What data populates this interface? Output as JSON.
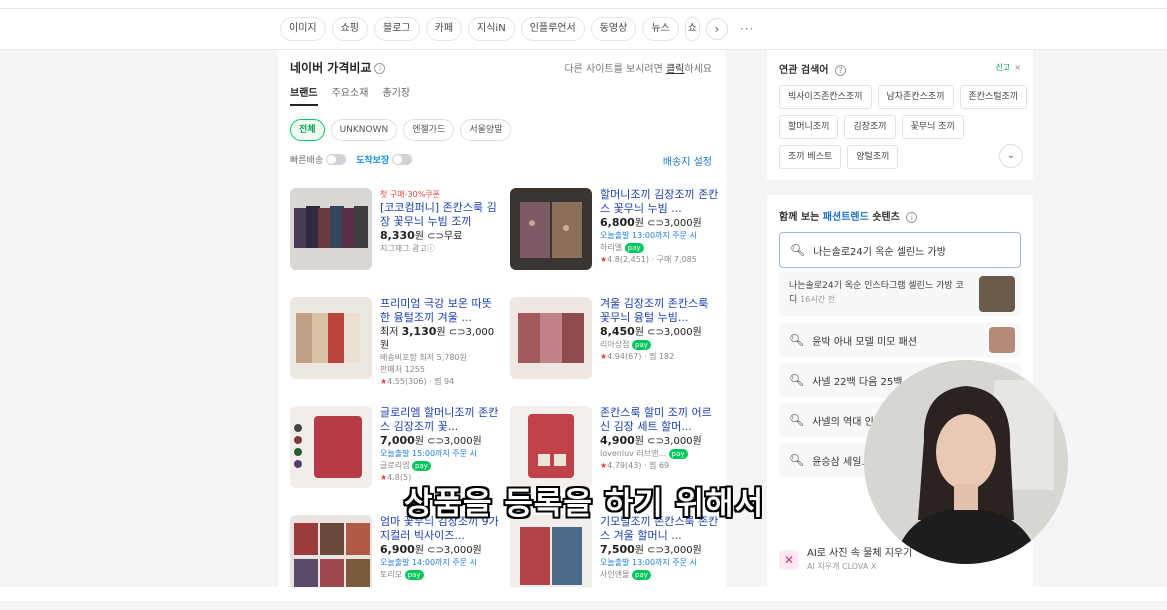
{
  "topbar": {
    "tabs": [
      "이미지",
      "쇼핑",
      "블로그",
      "카페",
      "지식iN",
      "인플루언서",
      "동영상",
      "뉴스",
      "쇼"
    ],
    "next": "›",
    "more": "···"
  },
  "price_compare": {
    "title": "네이버 가격비교",
    "info": "i",
    "right_text": "다른 사이트를 보시려면 ",
    "right_link": "클릭",
    "right_suffix": "하세요",
    "subtabs": [
      "브랜드",
      "주요소재",
      "총기장"
    ],
    "chips": [
      "전체",
      "UNKNOWN",
      "엔젤가드",
      "서울양말"
    ],
    "toggle_fast": "빠른배송",
    "toggle_arrival": "도착보장",
    "delivery_setting": "배송지 설정"
  },
  "products": [
    {
      "promo": "첫 구매-30%쿠폰",
      "title": "[코코컴퍼니] 존칸스룩 김장 꽃무늬 누빔 조끼",
      "price": "8,330",
      "price_suffix": "원 ⊂⊃무료",
      "line1": "지그재그 광고ⓘ",
      "line2": "",
      "rating": ""
    },
    {
      "promo": "",
      "title": "할머니조끼 김장조끼 존칸스 꽃무늬 누빔 ...",
      "price": "6,800",
      "price_suffix": "원 ⊂⊃3,000원",
      "line1": "오늘출발 13:00까지 주문 시",
      "line2": "하리엘",
      "rating": "4.8(2,451) · 구매 7,085"
    },
    {
      "promo": "",
      "title": "프리미엄 극강 보온 따뜻한 융털조끼 겨울 ...",
      "price": "3,130",
      "price_suffix": "원 ⊂⊃3,000원",
      "line1": "배송비포함 최저 5,780원",
      "line2": "판매처 1255",
      "rating": "4.55(306) · 찜 94",
      "price_prefix": "최저 "
    },
    {
      "promo": "",
      "title": "겨울 김장조끼 존칸스룩 꽃무늬 융털 누빔...",
      "price": "8,450",
      "price_suffix": "원 ⊂⊃3,000원",
      "line1": "리아상점",
      "line2": "",
      "rating": "4.94(67) · 찜 182"
    },
    {
      "promo": "",
      "title": "글로리엠 할머니조끼 존칸스 김장조끼 꽃...",
      "price": "7,000",
      "price_suffix": "원 ⊂⊃3,000원",
      "line1": "오늘출발 15:00까지 주문 시",
      "line2": "글로리엠",
      "rating": "4.8(5)"
    },
    {
      "promo": "",
      "title": "존칸스룩 할미 조끼 어르신 김장 세트 할머...",
      "price": "4,900",
      "price_suffix": "원 ⊂⊃3,000원",
      "line1": "lovenluv 러브앤...",
      "line2": "",
      "rating": "4.79(43) · 찜 69"
    },
    {
      "promo": "",
      "title": "엄마 꽃무늬 김장조끼 9가지컬러 빅사이즈...",
      "price": "6,900",
      "price_suffix": "원 ⊂⊃3,000원",
      "line1": "오늘출발 14:00까지 주문 시",
      "line2": "토리모",
      "rating": ""
    },
    {
      "promo": "",
      "title": "기모털조끼 존칸스룩 존칸스 겨울 할머니 ...",
      "price": "7,500",
      "price_suffix": "원 ⊂⊃3,000원",
      "line1": "오늘출발 13:00까지 주문 시",
      "line2": "사인앤몰",
      "rating": ""
    }
  ],
  "related": {
    "title": "연관 검색어",
    "ad": "신고",
    "close": "×",
    "keywords": [
      "빅사이즈존칸스조끼",
      "남자존칸스조끼",
      "존칸스털조끼",
      "할머니조끼",
      "김장조끼",
      "꽃무늬 조끼",
      "조끼 베스트",
      "양털조끼"
    ],
    "expand": "⌄"
  },
  "fashion": {
    "title_pre": "함께 보는 ",
    "title_hl": "패션트렌드",
    "title_post": " 숏텐츠",
    "selected_query": "나는솔로24기 옥순 셀린느 가방",
    "detail_text": "나는솔로24기 옥순 인스타그램 셀린느 가방 코디",
    "detail_time": "16시간 전",
    "queries": [
      "윤박 아내 모델 미모 패션",
      "사넬 22백 다음 25백 ...",
      "사넬의 역대 인...",
      "윤승삼 세일..."
    ],
    "ai_title": "AI로 사진 속 물체 지우기",
    "ai_sub": "AI 지우개 CLOVA X"
  },
  "caption": "상품을 등록을 하기 위해서",
  "icons": {
    "search": "search-icon",
    "info": "info-icon",
    "chevron": "chevron-down-icon"
  }
}
